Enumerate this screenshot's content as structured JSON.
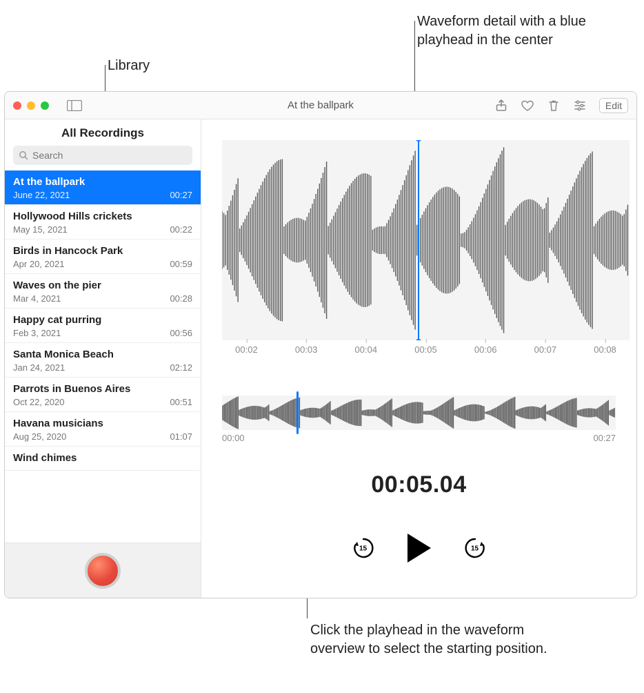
{
  "callouts": {
    "library": "Library",
    "waveform_detail": "Waveform detail with a blue playhead in the center",
    "overview_hint": "Click the playhead in the waveform overview to select the starting position."
  },
  "window": {
    "title": "At the ballpark",
    "edit_label": "Edit"
  },
  "sidebar": {
    "header": "All Recordings",
    "search_placeholder": "Search",
    "items": [
      {
        "name": "At the ballpark",
        "date": "June 22, 2021",
        "duration": "00:27",
        "selected": true
      },
      {
        "name": "Hollywood Hills crickets",
        "date": "May 15, 2021",
        "duration": "00:22"
      },
      {
        "name": "Birds in Hancock Park",
        "date": "Apr 20, 2021",
        "duration": "00:59"
      },
      {
        "name": "Waves on the pier",
        "date": "Mar 4, 2021",
        "duration": "00:28"
      },
      {
        "name": "Happy cat purring",
        "date": "Feb 3, 2021",
        "duration": "00:56"
      },
      {
        "name": "Santa Monica Beach",
        "date": "Jan 24, 2021",
        "duration": "02:12"
      },
      {
        "name": "Parrots in Buenos Aires",
        "date": "Oct 22, 2020",
        "duration": "00:51"
      },
      {
        "name": "Havana musicians",
        "date": "Aug 25, 2020",
        "duration": "01:07"
      },
      {
        "name": "Wind chimes",
        "date": "",
        "duration": ""
      }
    ]
  },
  "detail": {
    "timeline_ticks": [
      "00:02",
      "00:03",
      "00:04",
      "00:05",
      "00:06",
      "00:07",
      "00:08"
    ],
    "overview_start": "00:00",
    "overview_end": "00:27",
    "current_time": "00:05.04",
    "skip_amount": "15"
  },
  "colors": {
    "accent": "#0a79ff",
    "record": "#e74a3c"
  }
}
